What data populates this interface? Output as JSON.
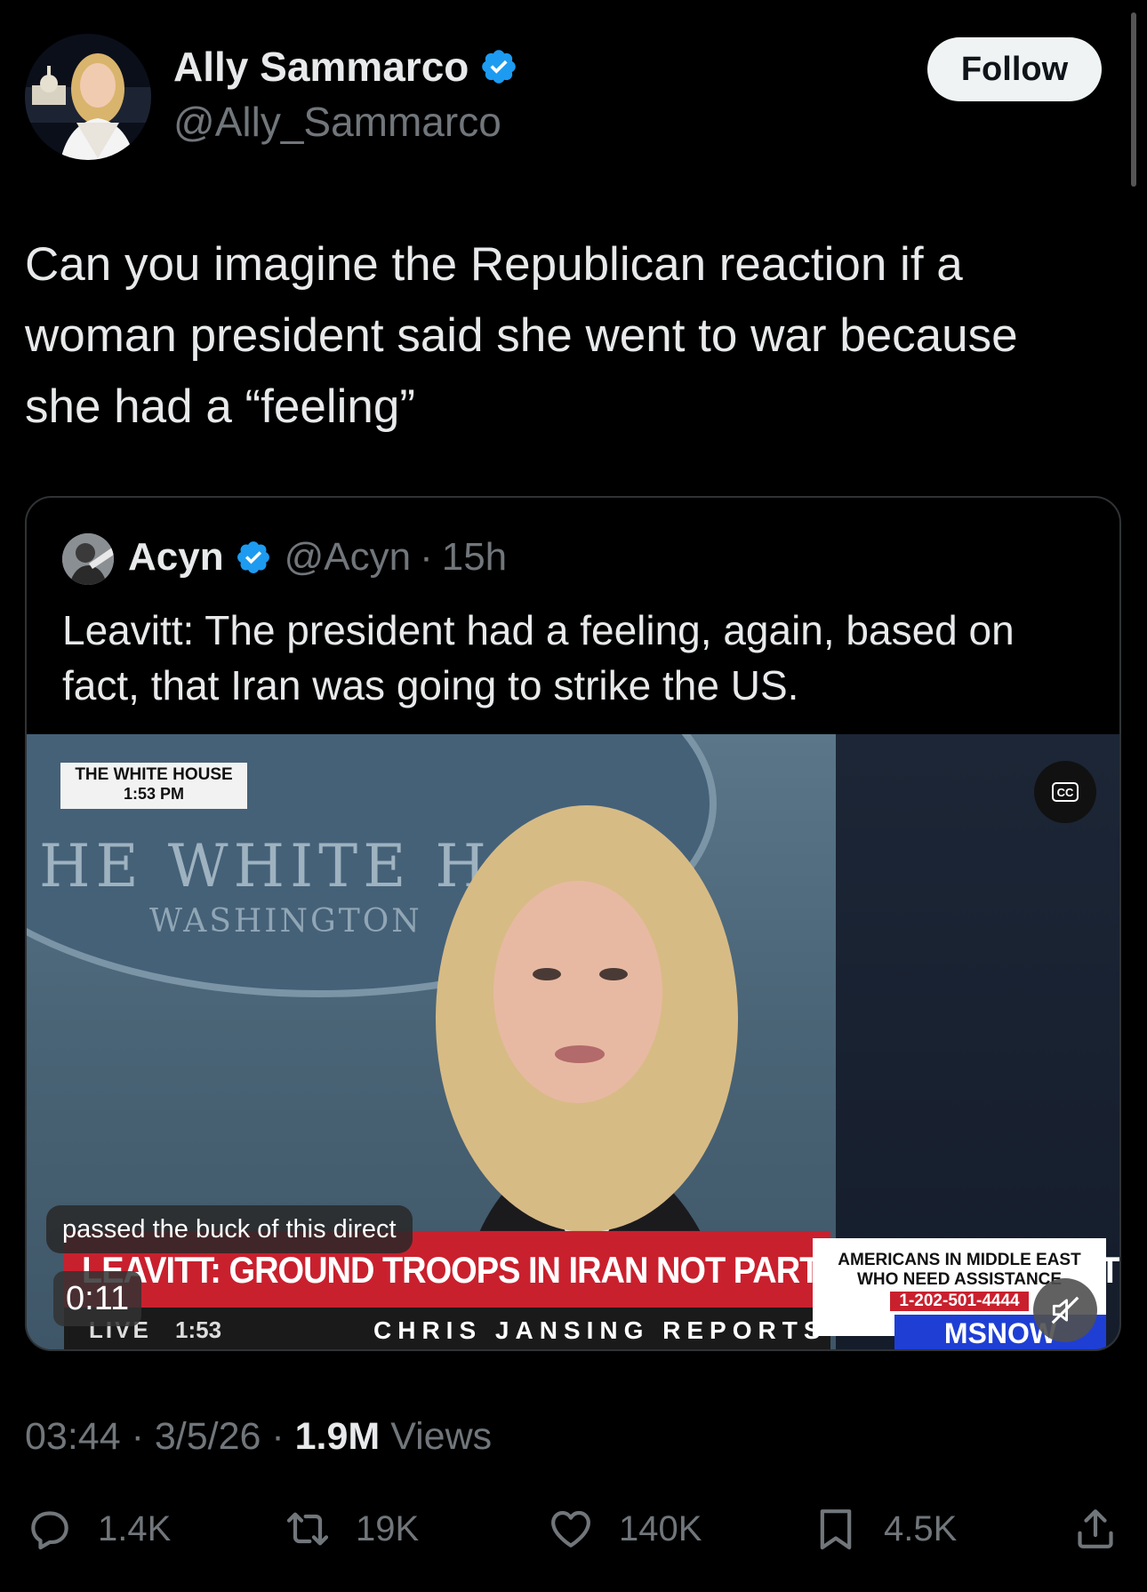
{
  "author": {
    "display_name": "Ally Sammarco",
    "handle": "@Ally_Sammarco",
    "follow_label": "Follow"
  },
  "tweet": {
    "text": "Can you imagine the Republican reaction if a woman president said she went to war because she had a “feeling”"
  },
  "quoted": {
    "display_name": "Acyn",
    "handle": "@Acyn",
    "separator": "·",
    "age": "15h",
    "text": "Leavitt: The president had a feeling, again, based on fact, that Iran was going to strike the US."
  },
  "video": {
    "stamp_line1": "THE WHITE HOUSE",
    "stamp_line2": "1:53 PM",
    "backdrop_text": "HE WHITE HOU",
    "backdrop_subtext": "WASHINGTON",
    "cc_label": "CC",
    "caption": "passed the buck of this direct",
    "ticker": "LEAVITT: GROUND TROOPS IN IRAN NOT PART OF THE PLAN AT THIS TIME",
    "live_label": "LIVE",
    "live_time": "1:53",
    "show_name": "CHRIS JANSING REPORTS",
    "side_line1": "AMERICANS IN MIDDLE EAST",
    "side_line2": "WHO NEED ASSISTANCE",
    "side_phone": "1-202-501-4444",
    "brand": "MSNOW",
    "timer": "0:11"
  },
  "meta": {
    "time": "03:44",
    "date": "3/5/26",
    "views_count": "1.9M",
    "views_label": "Views",
    "dot": "·"
  },
  "actions": {
    "replies": "1.4K",
    "reposts": "19K",
    "likes": "140K",
    "bookmarks": "4.5K"
  },
  "colors": {
    "background": "#000000",
    "text": "#e7e9ea",
    "secondary_text": "#71767b",
    "verified_blue": "#1d9bf0",
    "ticker_red": "#c9202e",
    "brand_blue": "#1f3fd4"
  }
}
